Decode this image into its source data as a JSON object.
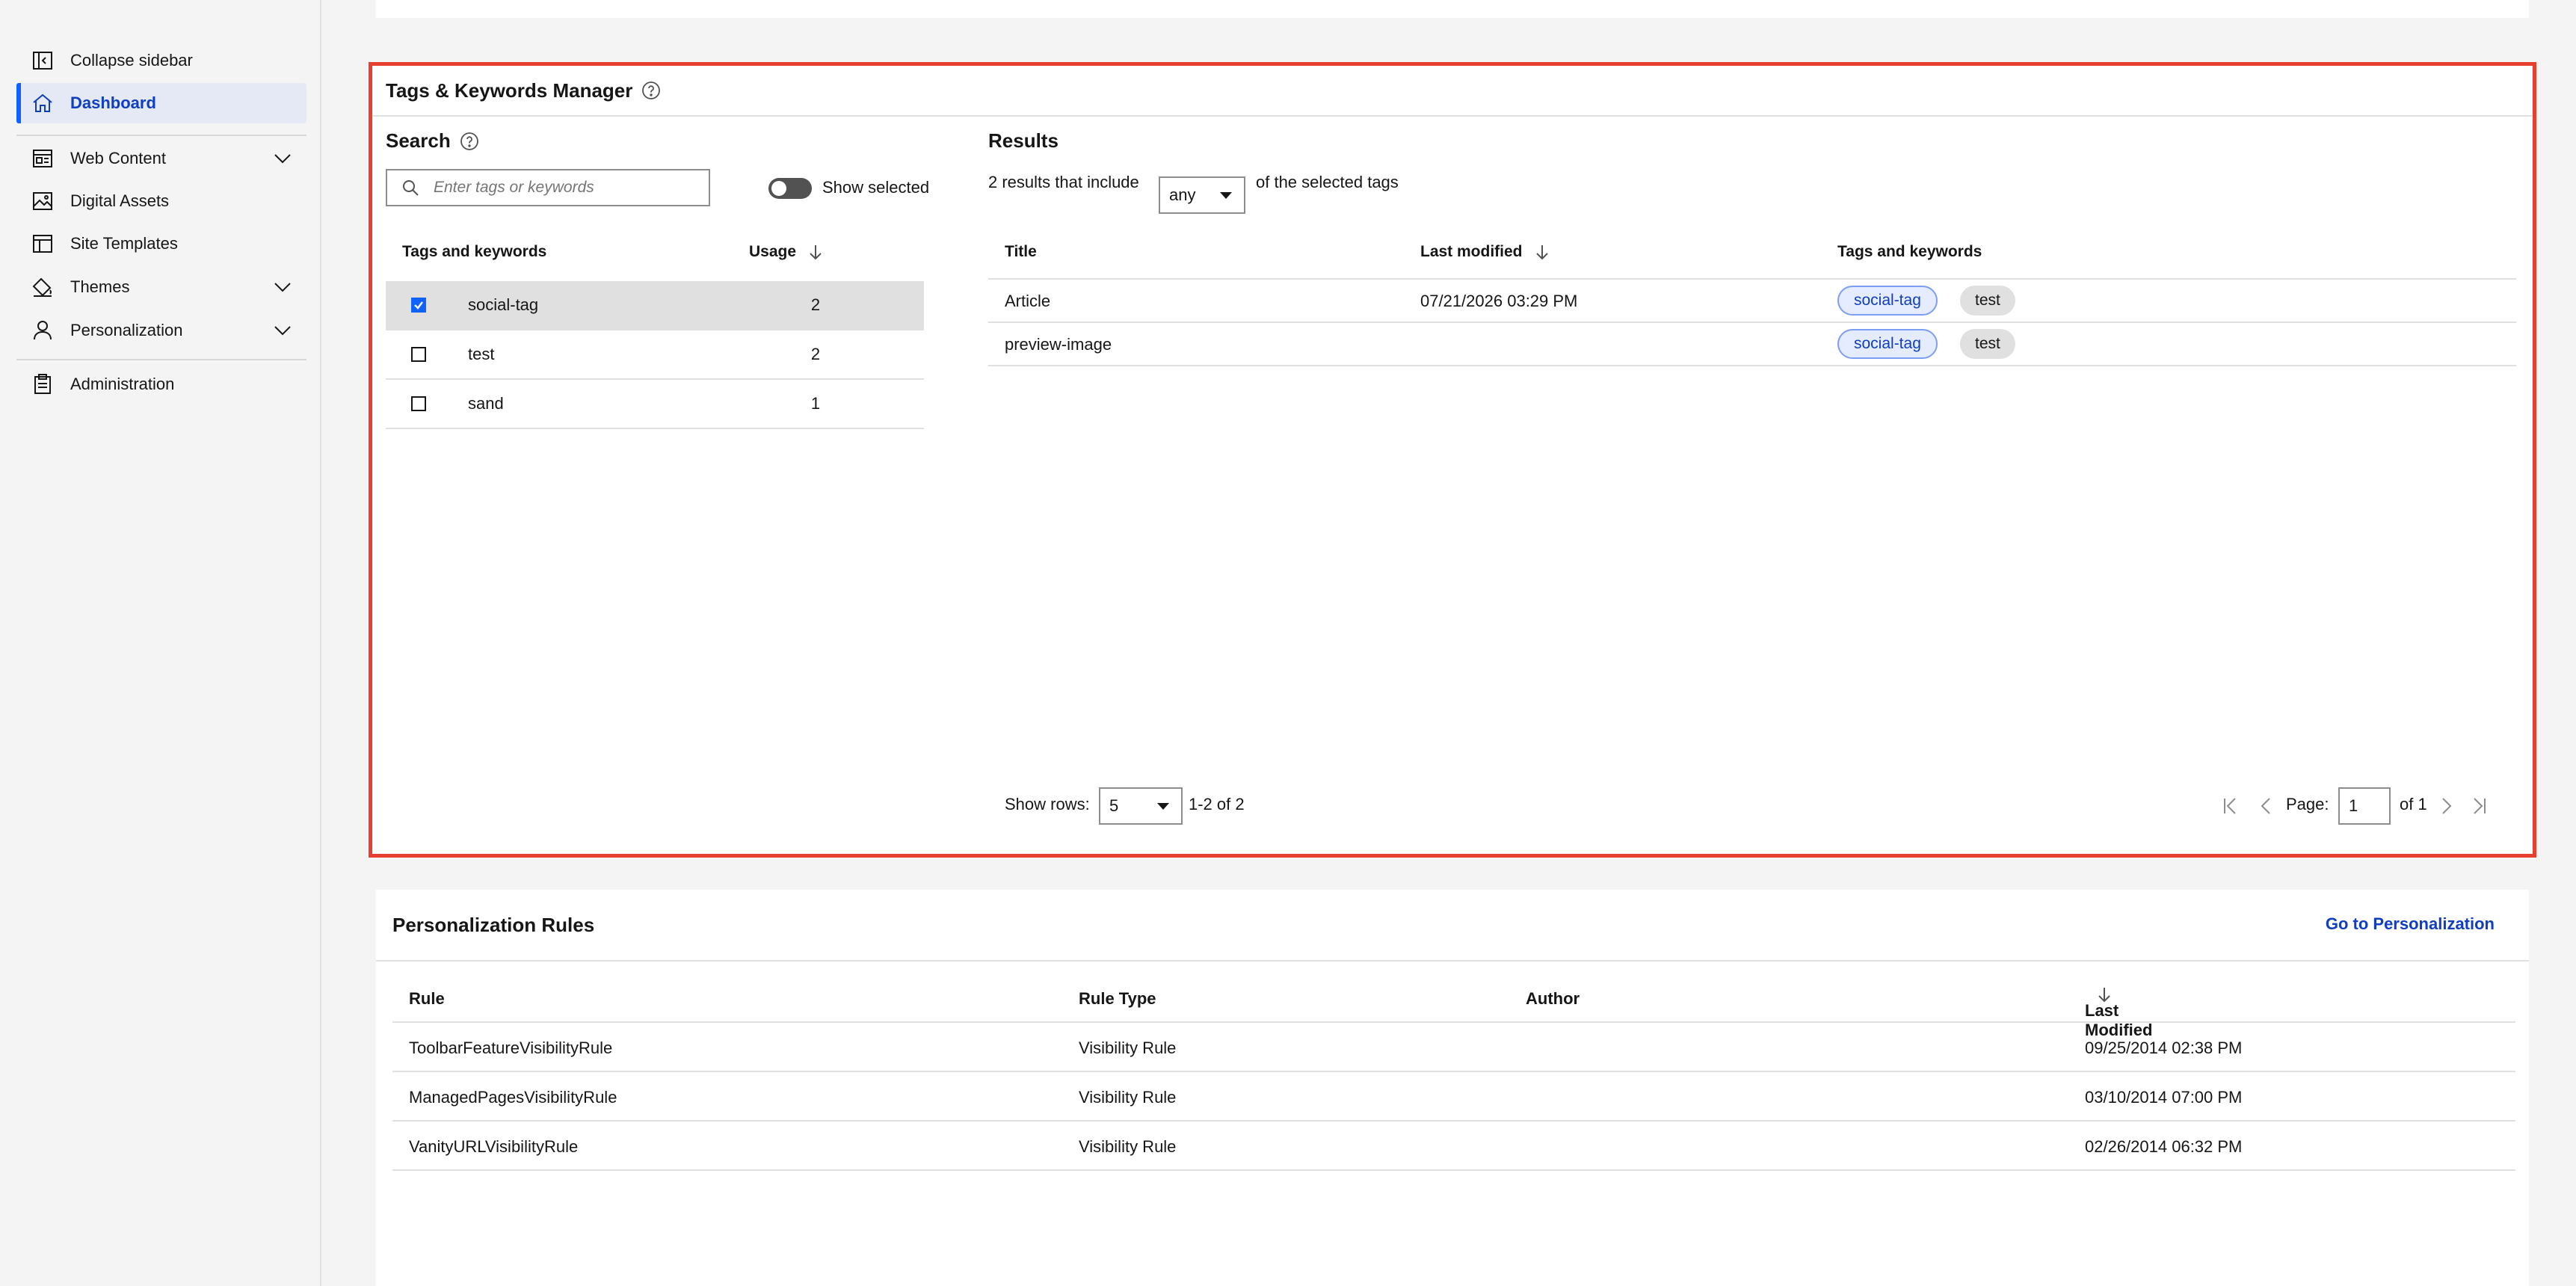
{
  "sidebar": {
    "items": [
      {
        "label": "Collapse sidebar"
      },
      {
        "label": "Dashboard"
      },
      {
        "label": "Web Content"
      },
      {
        "label": "Digital Assets"
      },
      {
        "label": "Site Templates"
      },
      {
        "label": "Themes"
      },
      {
        "label": "Personalization"
      },
      {
        "label": "Administration"
      }
    ]
  },
  "tags_manager": {
    "title": "Tags & Keywords Manager",
    "search": {
      "title": "Search",
      "placeholder": "Enter tags or keywords",
      "show_selected_label": "Show selected",
      "columns": {
        "tag": "Tags and keywords",
        "usage": "Usage"
      },
      "rows": [
        {
          "name": "social-tag",
          "usage": "2",
          "checked": true
        },
        {
          "name": "test",
          "usage": "2",
          "checked": false
        },
        {
          "name": "sand",
          "usage": "1",
          "checked": false
        }
      ]
    },
    "results": {
      "title": "Results",
      "summary_prefix": "2 results that include",
      "match_mode": "any",
      "summary_suffix": "of the selected tags",
      "columns": {
        "title": "Title",
        "last_modified": "Last modified",
        "tags": "Tags and keywords"
      },
      "rows": [
        {
          "title": "Article",
          "last_modified": "07/21/2026 03:29 PM",
          "tags": [
            "social-tag",
            "test"
          ]
        },
        {
          "title": "preview-image",
          "last_modified": "",
          "tags": [
            "social-tag",
            "test"
          ]
        }
      ],
      "pagination": {
        "show_rows_label": "Show rows:",
        "rows_per_page": "5",
        "range": "1-2 of 2",
        "page_label": "Page:",
        "page": "1",
        "of_pages": "of 1"
      }
    }
  },
  "personalization": {
    "title": "Personalization Rules",
    "link": "Go to Personalization",
    "columns": {
      "rule": "Rule",
      "type": "Rule Type",
      "author": "Author",
      "modified": "Last Modified"
    },
    "rows": [
      {
        "rule": "ToolbarFeatureVisibilityRule",
        "type": "Visibility Rule",
        "author": "",
        "modified": "09/25/2014 02:38 PM"
      },
      {
        "rule": "ManagedPagesVisibilityRule",
        "type": "Visibility Rule",
        "author": "",
        "modified": "03/10/2014 07:00 PM"
      },
      {
        "rule": "VanityURLVisibilityRule",
        "type": "Visibility Rule",
        "author": "",
        "modified": "02/26/2014 06:32 PM"
      }
    ]
  },
  "colors": {
    "accent": "#0f62fe",
    "highlight_border": "#e8402f",
    "link": "#0f3ec1"
  }
}
